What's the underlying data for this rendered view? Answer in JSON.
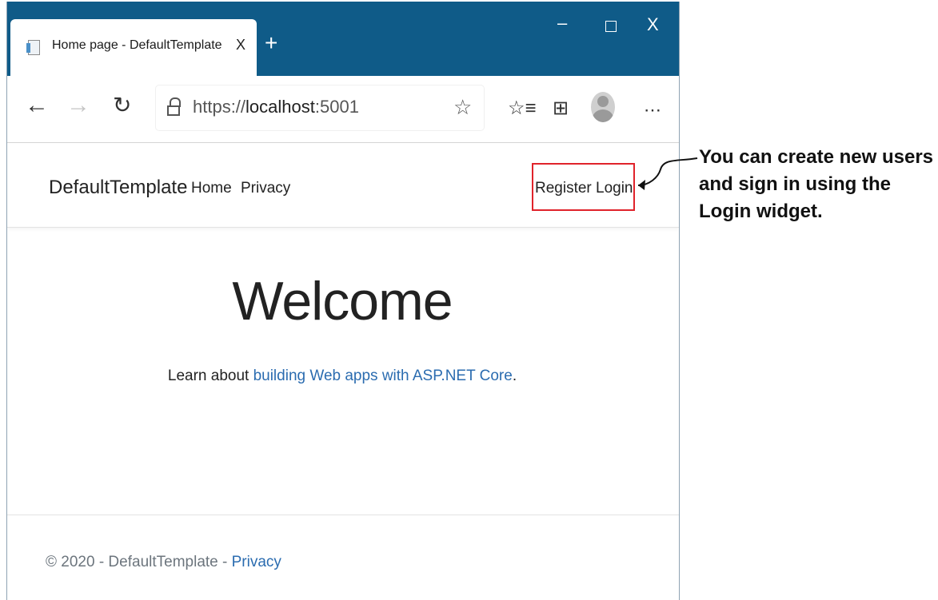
{
  "browser": {
    "tab_title": "Home page - DefaultTemplate",
    "tab_close": "X",
    "new_tab": "+",
    "window_controls": {
      "minimize": "–",
      "close": "X"
    },
    "url_prefix": "https://",
    "url_host": "localhost",
    "url_port": ":5001",
    "icons": [
      "back-icon",
      "forward-icon",
      "reload-icon",
      "lock-icon",
      "favorite-star-icon",
      "favorites-list-icon",
      "collections-icon",
      "profile-avatar",
      "more-icon"
    ]
  },
  "site": {
    "brand": "DefaultTemplate",
    "nav": {
      "home": "Home",
      "privacy": "Privacy",
      "register": "Register",
      "login": "Login"
    },
    "welcome": "Welcome",
    "learn_prefix": "Learn about ",
    "learn_link": "building Web apps with ASP.NET Core",
    "learn_suffix": ".",
    "footer_text": "© 2020 - DefaultTemplate - ",
    "footer_link": "Privacy"
  },
  "annotation": {
    "text": "You can create new users and sign in using the Login widget."
  },
  "colors": {
    "titlebar": "#0f5b88",
    "link": "#2b6cb0",
    "highlight_box": "#e0232b"
  }
}
